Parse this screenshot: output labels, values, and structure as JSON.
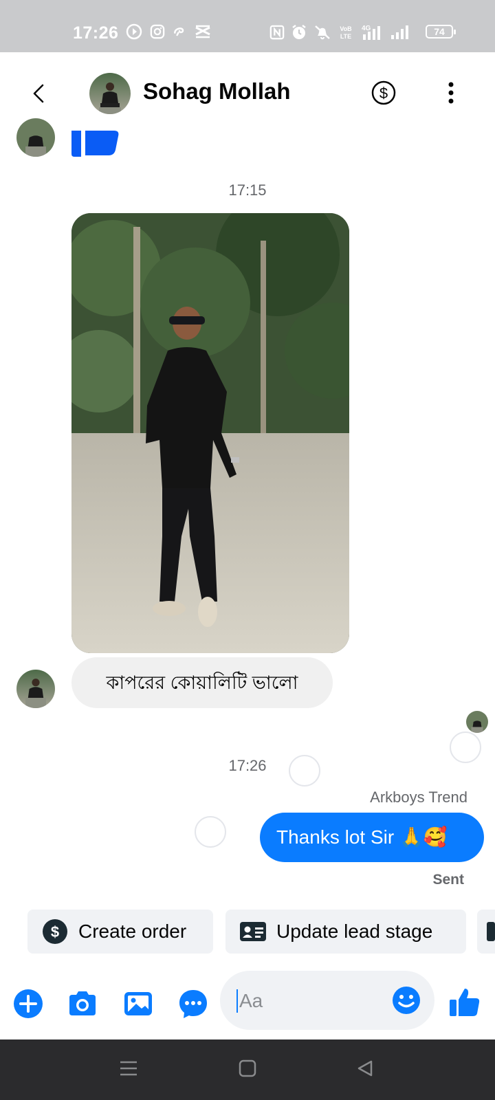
{
  "status_bar": {
    "time": "17:26",
    "battery": "74",
    "network": "4G",
    "left_icons": [
      "play-circle-icon",
      "instagram-icon",
      "swirl-icon",
      "capcut-icon"
    ],
    "right_icons": [
      "nfc-icon",
      "alarm-icon",
      "mute-icon",
      "volte-icon",
      "signal-icon",
      "signal-icon",
      "battery-icon"
    ]
  },
  "header": {
    "contact_name": "Sohag Mollah",
    "back_icon": "chevron-left-icon",
    "payment_icon": "dollar-circle-icon",
    "more_icon": "vertical-dots-icon"
  },
  "messages": {
    "timestamp_1": "17:15",
    "incoming_text": "কাপরের কোয়ালিটি ভালো",
    "timestamp_2": "17:26",
    "sender_label": "Arkboys Trend",
    "outgoing_text": "Thanks lot Sir 🙏🥰",
    "status": "Sent"
  },
  "actions": {
    "create_order": "Create order",
    "update_lead": "Update lead stage"
  },
  "composer": {
    "placeholder": "Aa",
    "icons": [
      "plus-circle-icon",
      "camera-icon",
      "gallery-icon",
      "chat-bubble-icon",
      "emoji-icon",
      "thumbs-up-icon"
    ]
  },
  "colors": {
    "accent": "#0a7cff",
    "status_bar_bg": "#c9cacc",
    "incoming_bubble": "#f0f0f0",
    "nav_bar_bg": "#2b2b2d"
  }
}
